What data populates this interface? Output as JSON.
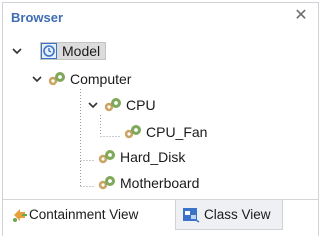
{
  "panel": {
    "title": "Browser",
    "close_glyph": "✕"
  },
  "tree": {
    "model": {
      "label": "Model",
      "icon": "model-icon"
    },
    "computer": {
      "label": "Computer",
      "icon": "component-icon"
    },
    "cpu": {
      "label": "CPU",
      "icon": "component-icon"
    },
    "cpu_fan": {
      "label": "CPU_Fan",
      "icon": "component-icon"
    },
    "hard_disk": {
      "label": "Hard_Disk",
      "icon": "component-icon"
    },
    "motherboard": {
      "label": "Motherboard",
      "icon": "component-icon"
    }
  },
  "tabs": {
    "containment": {
      "label": "Containment View",
      "icon": "containment-view-icon"
    },
    "class_view": {
      "label": "Class View",
      "icon": "class-view-icon"
    }
  },
  "colors": {
    "title": "#3e6db6",
    "gear_green": "#7fa85a",
    "gear_tan": "#c9a463",
    "model_icon": "#3b73c8"
  }
}
